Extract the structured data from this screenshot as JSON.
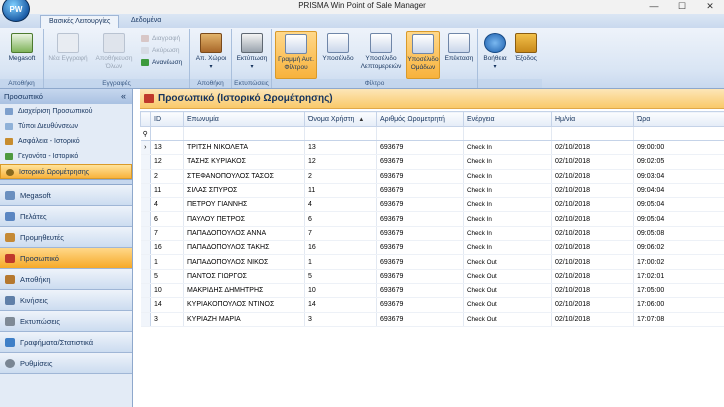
{
  "window": {
    "title": "PRISMA Win Point of Sale Manager",
    "minimize": "—",
    "maximize": "☐",
    "close": "✕",
    "logo": "PW"
  },
  "ribbon_tabs": [
    {
      "label": "Βασικές Λειτουργίες",
      "active": true
    },
    {
      "label": "Δεδομένα",
      "active": false
    }
  ],
  "ribbon": {
    "groups": [
      {
        "label": "Αποθήκη"
      },
      {
        "label": "Εγγραφές"
      },
      {
        "label": "Αποθήκη"
      },
      {
        "label": "Εκτυπώσεις"
      },
      {
        "label": "Φίλτρο"
      },
      {
        "label": ""
      }
    ],
    "buttons": {
      "megasoft": "Megasoft",
      "new_record": "Νέα Εγγραφή",
      "save_all": "Αποθήκευση Όλων",
      "delete": "Διαγραφή",
      "cancel": "Ακύρωση",
      "refresh": "Ανανέωση",
      "warehouses": "Απ. Χώροι",
      "print": "Εκτύπωση",
      "filter_row": "Γραμμή Αυτ. Φίλτρου",
      "subtotal": "Υποσέλιδο",
      "subtotal_details": "Υποσέλιδο Λεπτομερειών",
      "group_subtotal": "Υποσέλιδο Ομάδων",
      "expand": "Επέκταση",
      "help": "Βοήθεια",
      "exit": "Έξοδος"
    }
  },
  "sidebar": {
    "header": "Προσωπικό",
    "collapse_icon": "«",
    "items": [
      {
        "label": "Διαχείριση Προσωπικού",
        "selected": false
      },
      {
        "label": "Τύποι Διευθύνσεων",
        "selected": false
      },
      {
        "label": "Ασφάλεια - Ιστορικό",
        "selected": false
      },
      {
        "label": "Γεγονότα - Ιστορικό",
        "selected": false
      },
      {
        "label": "Ιστορικό Ωρομέτρησης",
        "selected": true
      }
    ],
    "nav": [
      {
        "label": "Megasoft",
        "selected": false
      },
      {
        "label": "Πελάτες",
        "selected": false
      },
      {
        "label": "Προμηθευτές",
        "selected": false
      },
      {
        "label": "Προσωπικό",
        "selected": true
      },
      {
        "label": "Αποθήκη",
        "selected": false
      },
      {
        "label": "Κινήσεις",
        "selected": false
      },
      {
        "label": "Εκτυπώσεις",
        "selected": false
      },
      {
        "label": "Γραφήματα/Στατιστικά",
        "selected": false
      },
      {
        "label": "Ρυθμίσεις",
        "selected": false
      }
    ]
  },
  "panel": {
    "title": "Προσωπικό (Ιστορικό Ωρομέτρησης)"
  },
  "grid": {
    "columns": [
      "ID",
      "Επωνυμία",
      "Όνομα Χρήστη",
      "Αριθμός Ωρομετρητή",
      "Ενέργεια",
      "Ημ/νία",
      "Ώρα"
    ],
    "sort_indicator": "▲",
    "filter_icon": "⚲",
    "current_row_marker": "›",
    "rows": [
      [
        "13",
        "ΤΡΙΤΣΗ  ΝΙΚΟΛΕΤΑ",
        "13",
        "693679",
        "Check In",
        "02/10/2018",
        "09:00:00"
      ],
      [
        "12",
        "ΤΑΣΗΣ  ΚΥΡΙΑΚΟΣ",
        "12",
        "693679",
        "Check In",
        "02/10/2018",
        "09:02:05"
      ],
      [
        "2",
        "ΣΤΕΦΑΝΟΠΟΥΛΟΣ  ΤΑΣΟΣ",
        "2",
        "693679",
        "Check In",
        "02/10/2018",
        "09:03:04"
      ],
      [
        "11",
        "ΣΙΛΑΣ  ΣΠΥΡΟΣ",
        "11",
        "693679",
        "Check In",
        "02/10/2018",
        "09:04:04"
      ],
      [
        "4",
        "ΠΕΤΡΟΥ  ΓΙΑΝΝΗΣ",
        "4",
        "693679",
        "Check In",
        "02/10/2018",
        "09:05:04"
      ],
      [
        "6",
        "ΠΑΥΛΟΥ  ΠΕΤΡΟΣ",
        "6",
        "693679",
        "Check In",
        "02/10/2018",
        "09:05:04"
      ],
      [
        "7",
        "ΠΑΠΑΔΟΠΟΥΛΟΣ  ΑΝΝΑ",
        "7",
        "693679",
        "Check In",
        "02/10/2018",
        "09:05:08"
      ],
      [
        "16",
        "ΠΑΠΑΔΟΠΟΥΛΟΣ  ΤΑΚΗΣ",
        "16",
        "693679",
        "Check In",
        "02/10/2018",
        "09:06:02"
      ],
      [
        "1",
        "ΠΑΠΑΔΟΠΟΥΛΟΣ  ΝΙΚΟΣ",
        "1",
        "693679",
        "Check Out",
        "02/10/2018",
        "17:00:02"
      ],
      [
        "5",
        "ΠΑΝΤΟΣ  ΓΙΩΡΓΟΣ",
        "5",
        "693679",
        "Check Out",
        "02/10/2018",
        "17:02:01"
      ],
      [
        "10",
        "ΜΑΚΡΙΔΗΣ  ΔΗΜΗΤΡΗΣ",
        "10",
        "693679",
        "Check Out",
        "02/10/2018",
        "17:05:00"
      ],
      [
        "14",
        "ΚΥΡΙΑΚΟΠΟΥΛΟΣ  ΝΤΙΝΟΣ",
        "14",
        "693679",
        "Check Out",
        "02/10/2018",
        "17:06:00"
      ],
      [
        "3",
        "ΚΥΡΙΑΖΗ  ΜΑΡΙΑ",
        "3",
        "693679",
        "Check Out",
        "02/10/2018",
        "17:07:08"
      ]
    ]
  },
  "colors": {
    "accent_orange": "#f8b23c",
    "ribbon_blue": "#d9e5f4",
    "text_blue": "#15335d"
  }
}
